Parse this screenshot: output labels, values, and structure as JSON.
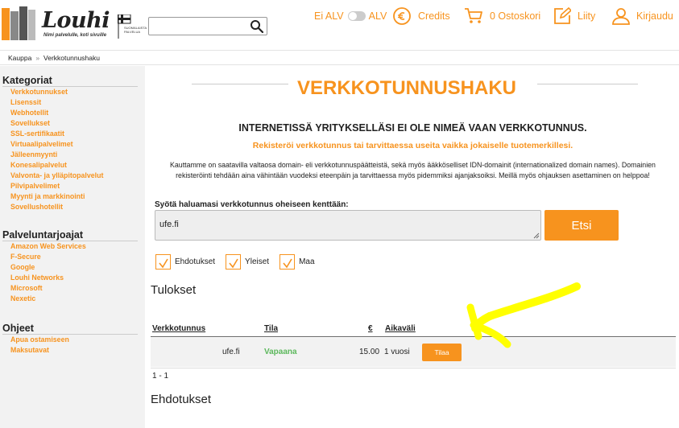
{
  "logo": {
    "name": "Louhi",
    "tagline": "Nimi palvelulle, koti sivuille",
    "flag_text": "SUOMALAISTA PALVELUA"
  },
  "search": {
    "value": "",
    "placeholder": ""
  },
  "header": {
    "alv_off": "Ei ALV",
    "alv_on": "ALV",
    "credits": "Credits",
    "cart": "0 Ostoskori",
    "join": "Liity",
    "login": "Kirjaudu"
  },
  "breadcrumb": {
    "home": "Kauppa",
    "separator": "»",
    "current": "Verkkotunnushaku"
  },
  "sidebar": {
    "categories_title": "Kategoriat",
    "categories": [
      "Verkkotunnukset",
      "Lisenssit",
      "Webhotellit",
      "Sovellukset",
      "SSL-sertifikaatit",
      "Virtuaalipalvelimet",
      "Jälleenmyynti",
      "Konesalipalvelut",
      "Valvonta- ja ylläpitopalvelut",
      "Pilvipalvelimet",
      "Myynti ja markkinointi",
      "Sovellushotellit"
    ],
    "providers_title": "Palveluntarjoajat",
    "providers": [
      "Amazon Web Services",
      "F-Secure",
      "Google",
      "Louhi Networks",
      "Microsoft",
      "Nexetic"
    ],
    "help_title": "Ohjeet",
    "help": [
      "Apua ostamiseen",
      "Maksutavat"
    ]
  },
  "main": {
    "title": "VERKKOTUNNUSHAKU",
    "subheading": "INTERNETISSÄ YRITYKSELLÄSI EI OLE NIMEÄ VAAN VERKKOTUNNUS.",
    "subline": "Rekisteröi verkkotunnus tai tarvittaessa useita vaikka jokaiselle tuotemerkillesi.",
    "description": "Kauttamme on saatavilla valtaosa domain- eli verkkotunnuspäätteistä, sekä myös ääkköselliset IDN-domainit (internationalized domain names). Domainien rekisteröinti tehdään aina vähintään vuodeksi eteenpäin ja tarvittaessa myös pidemmiksi ajanjaksoiksi. Meillä myös ohjauksen asettaminen on helppoa!",
    "input_label": "Syötä haluamasi verkkotunnus oheiseen kenttään:",
    "input_value": "ufe.fi",
    "search_button": "Etsi",
    "options": [
      "Ehdotukset",
      "Yleiset",
      "Maa"
    ],
    "results_title": "Tulokset",
    "columns": [
      "Verkkotunnus",
      "Tila",
      "€",
      "Aikaväli"
    ],
    "rows": [
      {
        "domain": "ufe.fi",
        "status": "Vapaana",
        "price": "15.00",
        "period": "1 vuosi",
        "action": "Tilaa"
      }
    ],
    "pager": "1 - 1",
    "suggestions_title": "Ehdotukset"
  },
  "colors": {
    "accent": "#f7931e",
    "available": "#5cb85c",
    "sidebar_bg": "#f2f2f2",
    "annotation": "#ffff00"
  }
}
